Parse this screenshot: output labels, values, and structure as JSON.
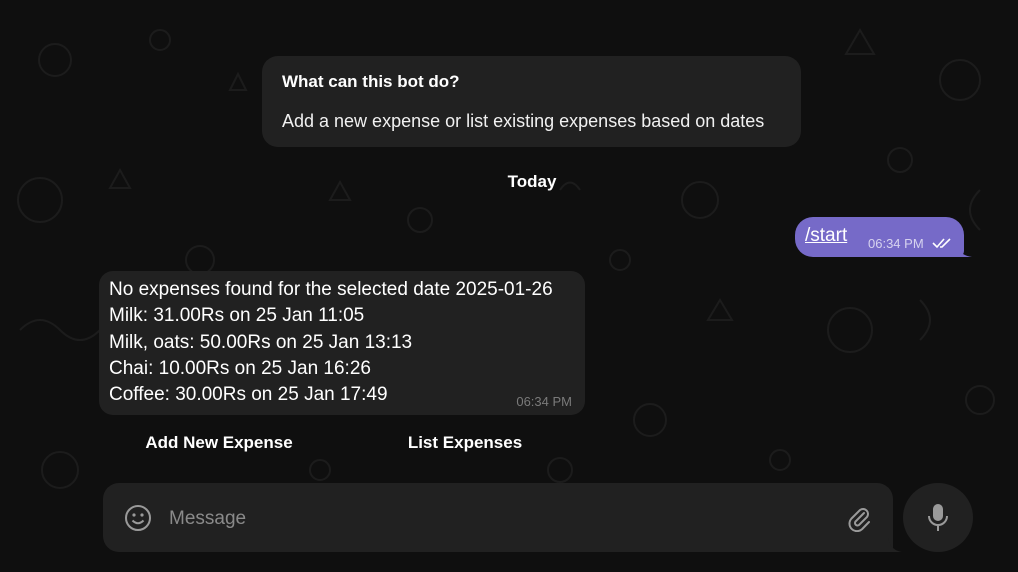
{
  "bot_info": {
    "title": "What can this bot do?",
    "description": "Add a new expense or list existing expenses based on dates"
  },
  "date_separator": "Today",
  "outgoing_message": {
    "text": "/start",
    "time": "06:34 PM",
    "status_icon": "double-check-icon"
  },
  "incoming_message": {
    "lines": [
      "No expenses found for the selected date 2025-01-26",
      "Milk: 31.00Rs on 25 Jan 11:05",
      "Milk, oats: 50.00Rs on 25 Jan 13:13",
      "Chai: 10.00Rs on 25 Jan 16:26",
      "Coffee: 30.00Rs on 25 Jan 17:49"
    ],
    "time": "06:34 PM"
  },
  "inline_keyboard": {
    "buttons": [
      "Add New Expense",
      "List Expenses"
    ]
  },
  "composer": {
    "placeholder": "Message",
    "emoji_icon": "smile-icon",
    "attach_icon": "paperclip-icon",
    "voice_icon": "microphone-icon"
  },
  "colors": {
    "background": "#0f0f0f",
    "bubble_incoming": "#212121",
    "bubble_outgoing": "#766ac8",
    "text_muted": "#7a7a7a"
  }
}
